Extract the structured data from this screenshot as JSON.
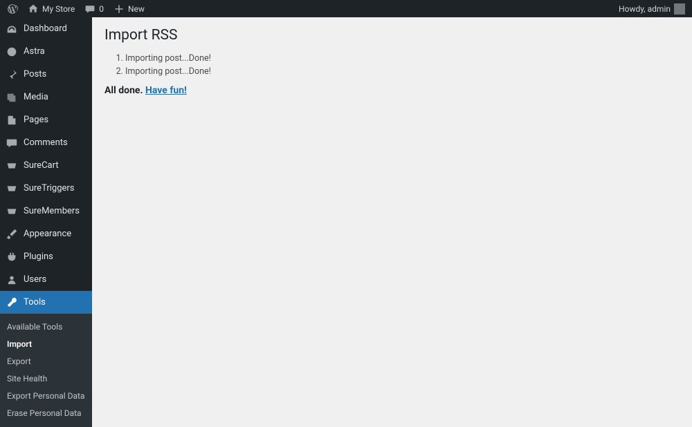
{
  "adminbar": {
    "site_name": "My Store",
    "comments_count": "0",
    "new_label": "New",
    "howdy": "Howdy, admin"
  },
  "sidebar": {
    "items": [
      {
        "label": "Dashboard",
        "icon": "dashboard"
      },
      {
        "label": "Astra",
        "icon": "astra"
      },
      {
        "label": "Posts",
        "icon": "posts"
      },
      {
        "label": "Media",
        "icon": "media"
      },
      {
        "label": "Pages",
        "icon": "pages"
      },
      {
        "label": "Comments",
        "icon": "comments"
      },
      {
        "label": "SureCart",
        "icon": "surecart"
      },
      {
        "label": "SureTriggers",
        "icon": "suretriggers"
      },
      {
        "label": "SureMembers",
        "icon": "suremembers"
      },
      {
        "label": "Appearance",
        "icon": "appearance"
      },
      {
        "label": "Plugins",
        "icon": "plugins"
      },
      {
        "label": "Users",
        "icon": "users"
      },
      {
        "label": "Tools",
        "icon": "tools"
      }
    ],
    "submenu": [
      "Available Tools",
      "Import",
      "Export",
      "Site Health",
      "Export Personal Data",
      "Erase Personal Data"
    ],
    "submenu_current": "Import"
  },
  "content": {
    "heading": "Import RSS",
    "log": [
      "Importing post...Done!",
      "Importing post...Done!"
    ],
    "done_text": "All done. ",
    "have_fun": "Have fun!"
  }
}
